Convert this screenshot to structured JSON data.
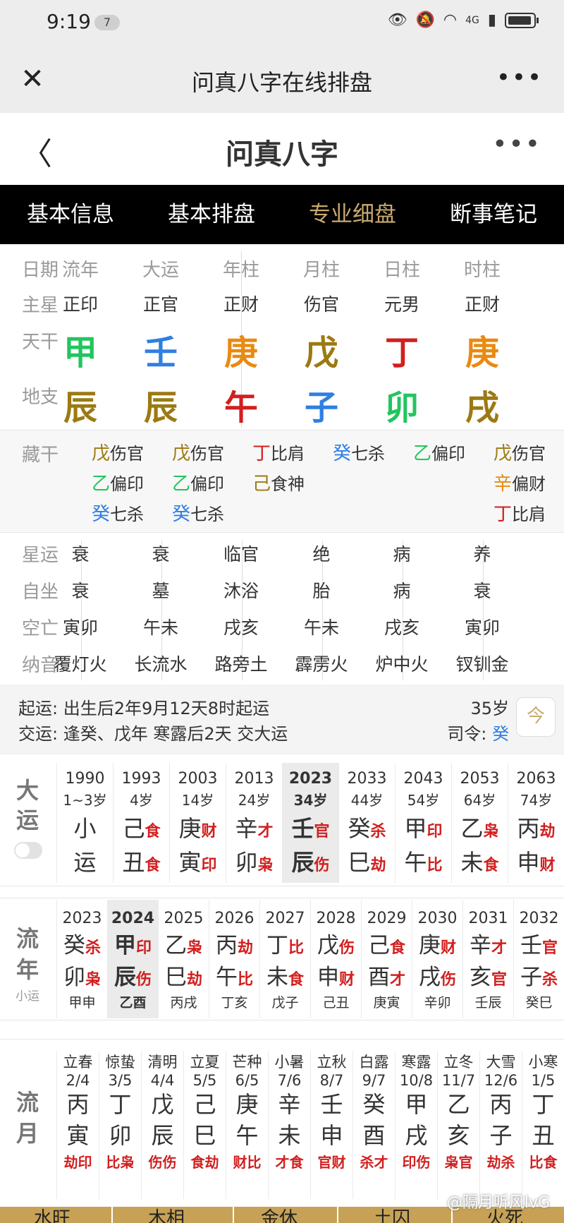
{
  "status_bar": {
    "time": "9:19",
    "badge": "7",
    "net": "4G"
  },
  "wechat_bar": {
    "title": "问真八字在线排盘"
  },
  "page_header": {
    "title": "问真八字"
  },
  "tabs": [
    {
      "label": "基本信息",
      "active": false
    },
    {
      "label": "基本排盘",
      "active": false
    },
    {
      "label": "专业细盘",
      "active": true
    },
    {
      "label": "断事笔记",
      "active": false
    }
  ],
  "pillars": {
    "row_labels": {
      "date": "日期",
      "main_star": "主星",
      "tiangan": "天干",
      "dizhi": "地支"
    },
    "columns": [
      {
        "header": "流年",
        "star": "正印",
        "stem": "甲",
        "stem_color": "#22c55e",
        "branch": "辰",
        "branch_color": "#9c7a12"
      },
      {
        "header": "大运",
        "star": "正官",
        "stem": "壬",
        "stem_color": "#2f7fe0",
        "branch": "辰",
        "branch_color": "#9c7a12"
      },
      {
        "header": "年柱",
        "star": "正财",
        "stem": "庚",
        "stem_color": "#e88a12",
        "branch": "午",
        "branch_color": "#d21f1f"
      },
      {
        "header": "月柱",
        "star": "伤官",
        "stem": "戊",
        "stem_color": "#9c7a12",
        "branch": "子",
        "branch_color": "#2f7fe0"
      },
      {
        "header": "日柱",
        "star": "元男",
        "stem": "丁",
        "stem_color": "#d21f1f",
        "branch": "卯",
        "branch_color": "#22c55e"
      },
      {
        "header": "时柱",
        "star": "正财",
        "stem": "庚",
        "stem_color": "#e88a12",
        "branch": "戌",
        "branch_color": "#9c7a12"
      }
    ]
  },
  "zanggan": {
    "label": "藏干",
    "columns": [
      [
        {
          "g": "戊",
          "c": "#9c7a12",
          "t": "伤官"
        },
        {
          "g": "乙",
          "c": "#22c55e",
          "t": "偏印"
        },
        {
          "g": "癸",
          "c": "#2f7fe0",
          "t": "七杀"
        }
      ],
      [
        {
          "g": "戊",
          "c": "#9c7a12",
          "t": "伤官"
        },
        {
          "g": "乙",
          "c": "#22c55e",
          "t": "偏印"
        },
        {
          "g": "癸",
          "c": "#2f7fe0",
          "t": "七杀"
        }
      ],
      [
        {
          "g": "丁",
          "c": "#d21f1f",
          "t": "比肩"
        },
        {
          "g": "己",
          "c": "#9c7a12",
          "t": "食神"
        }
      ],
      [
        {
          "g": "癸",
          "c": "#2f7fe0",
          "t": "七杀"
        }
      ],
      [
        {
          "g": "乙",
          "c": "#22c55e",
          "t": "偏印"
        }
      ],
      [
        {
          "g": "戊",
          "c": "#9c7a12",
          "t": "伤官"
        },
        {
          "g": "辛",
          "c": "#e88a12",
          "t": "偏财"
        },
        {
          "g": "丁",
          "c": "#d21f1f",
          "t": "比肩"
        }
      ]
    ]
  },
  "xingyun": {
    "labels": [
      "星运",
      "自坐",
      "空亡",
      "纳音"
    ],
    "rows": [
      [
        "衰",
        "衰",
        "临官",
        "绝",
        "病",
        "养"
      ],
      [
        "衰",
        "墓",
        "沐浴",
        "胎",
        "病",
        "衰"
      ],
      [
        "寅卯",
        "午未",
        "戌亥",
        "午未",
        "戌亥",
        "寅卯"
      ],
      [
        "覆灯火",
        "长流水",
        "路旁土",
        "霹雳火",
        "炉中火",
        "钗钏金"
      ]
    ]
  },
  "qiyun": {
    "line1_label": "起运:",
    "line1_text": "出生后2年9月12天8时起运",
    "line2_label": "交运:",
    "line2_text": "逢癸、戊年 寒露后2天 交大运",
    "age": "35岁",
    "siling_label": "司令:",
    "siling_value": "癸",
    "cal_icon": "今"
  },
  "dayun": {
    "label_1": "大",
    "label_2": "运",
    "columns": [
      {
        "year": "1990",
        "age": "1~3岁",
        "g1": "小",
        "s1": "",
        "g2": "运",
        "s2": ""
      },
      {
        "year": "1993",
        "age": "4岁",
        "g1": "己",
        "s1": "食",
        "g2": "丑",
        "s2": "食"
      },
      {
        "year": "2003",
        "age": "14岁",
        "g1": "庚",
        "s1": "财",
        "g2": "寅",
        "s2": "印"
      },
      {
        "year": "2013",
        "age": "24岁",
        "g1": "辛",
        "s1": "才",
        "g2": "卯",
        "s2": "枭"
      },
      {
        "year": "2023",
        "age": "34岁",
        "g1": "壬",
        "s1": "官",
        "g2": "辰",
        "s2": "伤",
        "hl": true
      },
      {
        "year": "2033",
        "age": "44岁",
        "g1": "癸",
        "s1": "杀",
        "g2": "巳",
        "s2": "劫"
      },
      {
        "year": "2043",
        "age": "54岁",
        "g1": "甲",
        "s1": "印",
        "g2": "午",
        "s2": "比"
      },
      {
        "year": "2053",
        "age": "64岁",
        "g1": "乙",
        "s1": "枭",
        "g2": "未",
        "s2": "食"
      },
      {
        "year": "2063",
        "age": "74岁",
        "g1": "丙",
        "s1": "劫",
        "g2": "申",
        "s2": "财"
      }
    ]
  },
  "liunian": {
    "label_1": "流",
    "label_2": "年",
    "sub_label": "小运",
    "columns": [
      {
        "year": "2023",
        "g1": "癸",
        "s1": "杀",
        "g2": "卯",
        "s2": "枭",
        "x": "甲申"
      },
      {
        "year": "2024",
        "g1": "甲",
        "s1": "印",
        "g2": "辰",
        "s2": "伤",
        "x": "乙酉",
        "hl": true
      },
      {
        "year": "2025",
        "g1": "乙",
        "s1": "枭",
        "g2": "巳",
        "s2": "劫",
        "x": "丙戌"
      },
      {
        "year": "2026",
        "g1": "丙",
        "s1": "劫",
        "g2": "午",
        "s2": "比",
        "x": "丁亥"
      },
      {
        "year": "2027",
        "g1": "丁",
        "s1": "比",
        "g2": "未",
        "s2": "食",
        "x": "戊子"
      },
      {
        "year": "2028",
        "g1": "戊",
        "s1": "伤",
        "g2": "申",
        "s2": "财",
        "x": "己丑"
      },
      {
        "year": "2029",
        "g1": "己",
        "s1": "食",
        "g2": "酉",
        "s2": "才",
        "x": "庚寅"
      },
      {
        "year": "2030",
        "g1": "庚",
        "s1": "财",
        "g2": "戌",
        "s2": "伤",
        "x": "辛卯"
      },
      {
        "year": "2031",
        "g1": "辛",
        "s1": "才",
        "g2": "亥",
        "s2": "官",
        "x": "壬辰"
      },
      {
        "year": "2032",
        "g1": "壬",
        "s1": "官",
        "g2": "子",
        "s2": "杀",
        "x": "癸巳"
      }
    ]
  },
  "liuyue": {
    "label_1": "流",
    "label_2": "月",
    "columns": [
      {
        "term": "立春",
        "date": "2/4",
        "g1": "丙",
        "g2": "寅",
        "s": "劫印"
      },
      {
        "term": "惊蛰",
        "date": "3/5",
        "g1": "丁",
        "g2": "卯",
        "s": "比枭"
      },
      {
        "term": "清明",
        "date": "4/4",
        "g1": "戊",
        "g2": "辰",
        "s": "伤伤"
      },
      {
        "term": "立夏",
        "date": "5/5",
        "g1": "己",
        "g2": "巳",
        "s": "食劫"
      },
      {
        "term": "芒种",
        "date": "6/5",
        "g1": "庚",
        "g2": "午",
        "s": "财比"
      },
      {
        "term": "小暑",
        "date": "7/6",
        "g1": "辛",
        "g2": "未",
        "s": "才食"
      },
      {
        "term": "立秋",
        "date": "8/7",
        "g1": "壬",
        "g2": "申",
        "s": "官财"
      },
      {
        "term": "白露",
        "date": "9/7",
        "g1": "癸",
        "g2": "酉",
        "s": "杀才"
      },
      {
        "term": "寒露",
        "date": "10/8",
        "g1": "甲",
        "g2": "戌",
        "s": "印伤"
      },
      {
        "term": "立冬",
        "date": "11/7",
        "g1": "乙",
        "g2": "亥",
        "s": "枭官"
      },
      {
        "term": "大雪",
        "date": "12/6",
        "g1": "丙",
        "g2": "子",
        "s": "劫杀"
      },
      {
        "term": "小寒",
        "date": "1/5",
        "g1": "丁",
        "g2": "丑",
        "s": "比食"
      }
    ]
  },
  "bottom_bar": [
    "水旺",
    "木相",
    "金休",
    "土囚",
    "火死"
  ],
  "watermark": "@隔月听风lvG"
}
